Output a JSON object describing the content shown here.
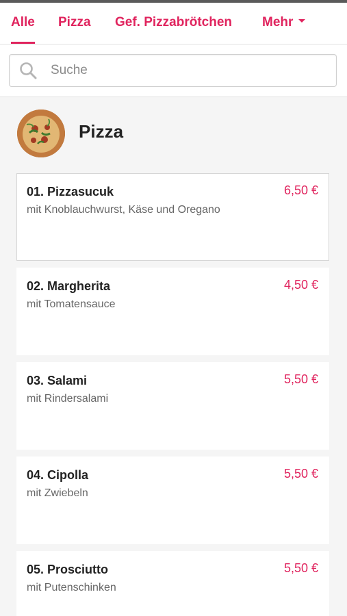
{
  "tabs": [
    {
      "label": "Alle",
      "active": true
    },
    {
      "label": "Pizza"
    },
    {
      "label": "Gef. Pizzabrötchen"
    },
    {
      "label": "Mehr",
      "dropdown": true
    }
  ],
  "search": {
    "placeholder": "Suche",
    "value": ""
  },
  "category": {
    "title": "Pizza",
    "image": "pizza-photo"
  },
  "items": [
    {
      "name": "01. Pizzasucuk",
      "description": "mit Knoblauchwurst, Käse und Oregano",
      "price": "6,50 €"
    },
    {
      "name": "02. Margherita",
      "description": "mit Tomatensauce",
      "price": "4,50 €"
    },
    {
      "name": "03. Salami",
      "description": "mit Rindersalami",
      "price": "5,50 €"
    },
    {
      "name": "04. Cipolla",
      "description": "mit Zwiebeln",
      "price": "5,50 €"
    },
    {
      "name": "05. Prosciutto",
      "description": "mit Putenschinken",
      "price": "5,50 €"
    }
  ],
  "colors": {
    "accent": "#e0245e",
    "background": "#f5f5f5",
    "card": "#ffffff"
  }
}
